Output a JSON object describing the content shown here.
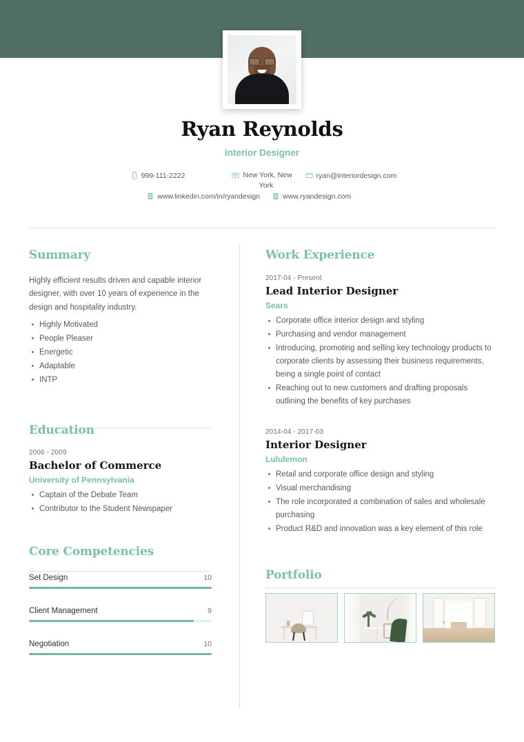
{
  "theme": {
    "band_color": "#506e63",
    "accent_color": "#7ac0ab",
    "rule_color": "#cfe6de",
    "bar_fill": "#6fb9a3",
    "bar_track": "#dff0ea"
  },
  "identity": {
    "name": "Ryan Reynolds",
    "title": "Interior Designer",
    "photo_alt": "profile-photo"
  },
  "contact": {
    "phone": "999-111-2222",
    "location_line1": "New York, New",
    "location_line2": "York",
    "email": "ryan@interiordesign.com",
    "linkedin": "www.linkedin.com/in/ryandesign",
    "website": "www.ryandesign.com",
    "icons": {
      "phone": "phone-icon",
      "location": "location-icon",
      "email": "email-icon",
      "linkedin": "link-icon",
      "website": "link-icon"
    }
  },
  "summary": {
    "heading": "Summary",
    "paragraph": "Highly efficient results driven and capable interior designer, with over 10 years of experience in the design and hospitality industry.",
    "bullets": [
      "Highly Motivated",
      "People Pleaser",
      "Energetic",
      "Adaptable",
      "INTP"
    ]
  },
  "education": {
    "heading": "Education",
    "entries": [
      {
        "date": "2006 - 2009",
        "degree": "Bachelor of Commerce",
        "school": "University of Pennsylvania",
        "bullets": [
          "Captain of the Debate Team",
          "Contributor to the Student Newspaper"
        ]
      }
    ]
  },
  "competencies": {
    "heading": "Core Competencies",
    "max": 10,
    "skills": [
      {
        "name": "Set Design",
        "score": "10",
        "value": 10
      },
      {
        "name": "Client Management",
        "score": "9",
        "value": 9
      },
      {
        "name": "Negotiation",
        "score": "10",
        "value": 10
      }
    ]
  },
  "work": {
    "heading": "Work Experience",
    "entries": [
      {
        "date": "2017-04 - Present",
        "role": "Lead Interior Designer",
        "company": "Sears",
        "bullets": [
          "Corporate office interior design and styling",
          "Purchasing and vendor management",
          "Introducing, promoting and selling key technology products to corporate clients by assessing their business requirements, being a single point of contact",
          "Reaching out to new customers and drafting proposals outlining the benefits of key purchases"
        ]
      },
      {
        "date": "2014-04 - 2017-03",
        "role": "Interior Designer",
        "company": "Lululemon",
        "bullets": [
          "Retail and corporate office design and styling",
          "Visual merchandising",
          "The role incorporated a combination of sales and wholesale purchasing",
          "Product R&D and innovation was a key element of this role"
        ]
      }
    ]
  },
  "portfolio": {
    "heading": "Portfolio",
    "items": [
      {
        "alt": "portfolio-image-desk-and-chair"
      },
      {
        "alt": "portfolio-image-dining-table-with-plants"
      },
      {
        "alt": "portfolio-image-white-doorway"
      }
    ]
  }
}
